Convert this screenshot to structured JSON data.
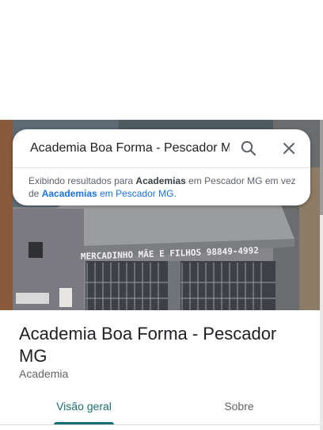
{
  "search": {
    "value": "Academia Boa Forma - Pescador MG",
    "notice_prefix": "Exibindo resultados para ",
    "notice_term": "Academias",
    "notice_mid": " em Pescador MG em vez de ",
    "notice_alt_term": "Aacademias",
    "notice_alt_suffix": " em Pescador MG",
    "notice_end": "."
  },
  "photo": {
    "sign_text": "MERCADINHO MÃE E FILHOS  98849-4992"
  },
  "place": {
    "title": "Academia Boa Forma - Pescador MG",
    "category": "Academia"
  },
  "tabs": [
    {
      "label": "Visão geral",
      "selected": true
    },
    {
      "label": "Sobre",
      "selected": false
    }
  ],
  "colors": {
    "accent": "#1a6f73",
    "link": "#1a73e8"
  }
}
